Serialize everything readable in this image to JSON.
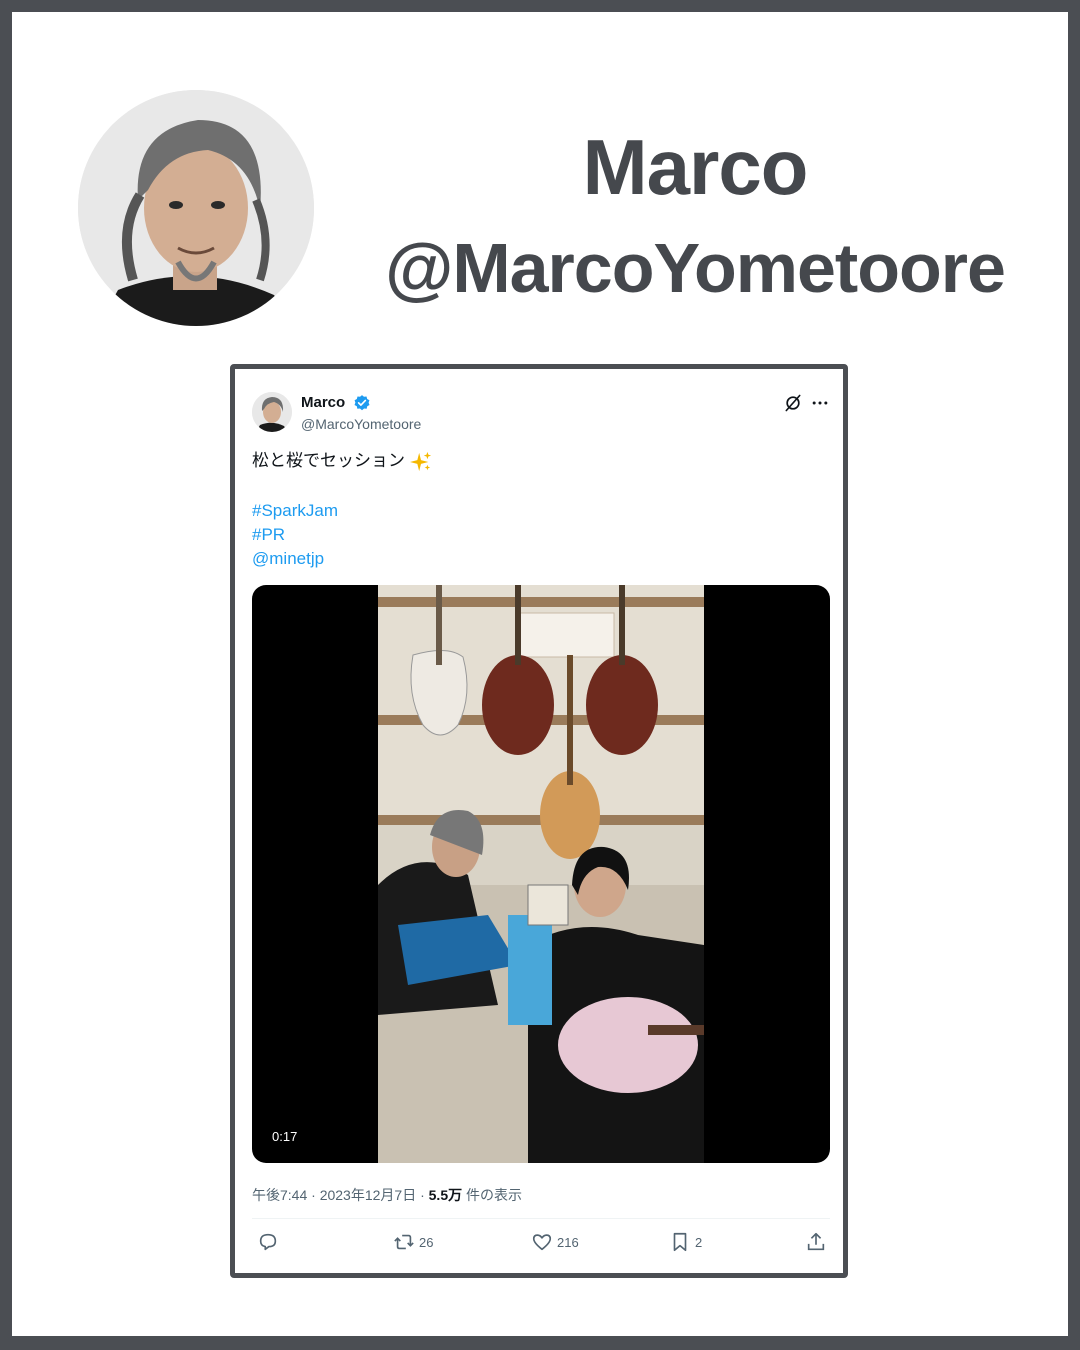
{
  "header": {
    "name": "Marco",
    "handle": "@MarcoYometoore"
  },
  "tweet": {
    "author_name": "Marco",
    "author_handle": "@MarcoYometoore",
    "text": "松と桜でセッション",
    "hashtags": [
      "#SparkJam",
      "#PR"
    ],
    "mention": "@minetjp",
    "video_duration": "0:17",
    "timestamp": "午後7:44 · 2023年12月7日 · ",
    "views_count": "5.5万",
    "views_label": " 件の表示",
    "actions": {
      "reply_icon": "reply-icon",
      "retweet_count": "26",
      "like_count": "216",
      "bookmark_count": "2",
      "share_icon": "share-icon"
    }
  },
  "colors": {
    "border": "#4b4e53",
    "accent": "#1d9bf0",
    "verified": "#1d9bf0",
    "text": "#0f1419",
    "secondary": "#536471"
  }
}
